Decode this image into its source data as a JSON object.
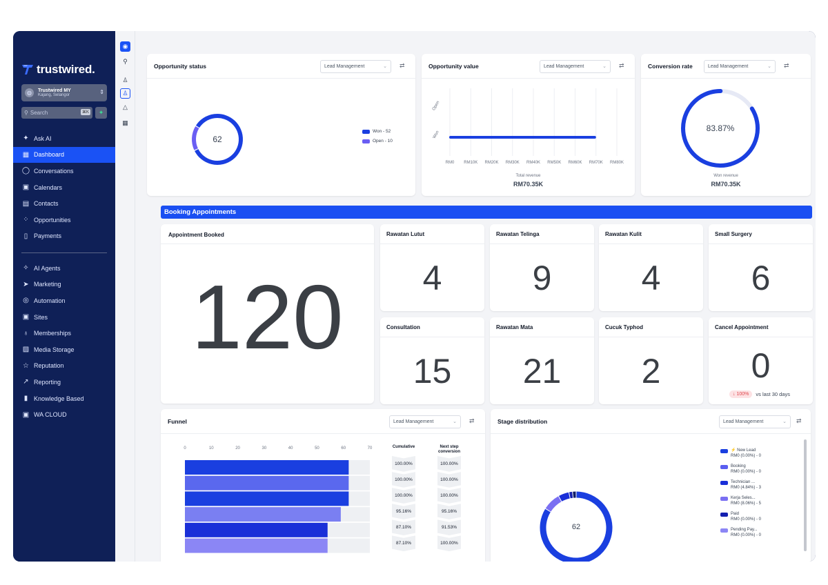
{
  "brand": {
    "name": "trustwired."
  },
  "account": {
    "name": "Trustwired MY",
    "location": "Kajang, Selangor"
  },
  "search": {
    "placeholder": "Search",
    "shortcut": "⌘K"
  },
  "nav_top": [
    {
      "label": "Ask AI",
      "icon": "sparkle-icon",
      "glyph": "✦"
    },
    {
      "label": "Dashboard",
      "icon": "dashboard-icon",
      "glyph": "▦",
      "active": true
    },
    {
      "label": "Conversations",
      "icon": "chat-icon",
      "glyph": "◯"
    },
    {
      "label": "Calendars",
      "icon": "calendar-icon",
      "glyph": "▣"
    },
    {
      "label": "Contacts",
      "icon": "contacts-icon",
      "glyph": "▤"
    },
    {
      "label": "Opportunities",
      "icon": "opportunities-icon",
      "glyph": "⁘"
    },
    {
      "label": "Payments",
      "icon": "payments-icon",
      "glyph": "▯"
    }
  ],
  "nav_bottom": [
    {
      "label": "AI Agents",
      "icon": "ai-agents-icon",
      "glyph": "✧"
    },
    {
      "label": "Marketing",
      "icon": "send-icon",
      "glyph": "➤"
    },
    {
      "label": "Automation",
      "icon": "automation-icon",
      "glyph": "◎"
    },
    {
      "label": "Sites",
      "icon": "sites-icon",
      "glyph": "▣"
    },
    {
      "label": "Memberships",
      "icon": "membership-icon",
      "glyph": "♁"
    },
    {
      "label": "Media Storage",
      "icon": "media-icon",
      "glyph": "▨"
    },
    {
      "label": "Reputation",
      "icon": "star-icon",
      "glyph": "☆"
    },
    {
      "label": "Reporting",
      "icon": "reporting-icon",
      "glyph": "↗"
    },
    {
      "label": "Knowledge Based",
      "icon": "book-icon",
      "glyph": "▮"
    },
    {
      "label": "WA CLOUD",
      "icon": "cloud-icon",
      "glyph": "▣"
    }
  ],
  "opportunity_status": {
    "title": "Opportunity status",
    "filter": "Lead Management",
    "total": "62",
    "legend": [
      {
        "label": "Won - 52",
        "value": 52,
        "color": "#1a3fe0"
      },
      {
        "label": "Open - 10",
        "value": 10,
        "color": "#6a5ef3"
      }
    ]
  },
  "opportunity_value": {
    "title": "Opportunity value",
    "filter": "Lead Management",
    "y_labels": [
      "Open",
      "Won"
    ],
    "x_ticks": [
      "RM0",
      "RM10K",
      "RM20K",
      "RM30K",
      "RM40K",
      "RM50K",
      "RM60K",
      "RM70K",
      "RM80K"
    ],
    "won_value": 70.35,
    "caption": "Total revenue",
    "total": "RM70.35K"
  },
  "conversion_rate": {
    "title": "Conversion rate",
    "filter": "Lead Management",
    "percent_label": "83.87%",
    "percent": 83.87,
    "caption": "Won revenue",
    "total": "RM70.35K"
  },
  "section": {
    "title": "Booking Appointments"
  },
  "appointment_booked": {
    "title": "Appointment Booked",
    "value": "120"
  },
  "stats": [
    {
      "title": "Rawatan Lutut",
      "value": "4"
    },
    {
      "title": "Rawatan Telinga",
      "value": "9"
    },
    {
      "title": "Rawatan Kulit",
      "value": "4"
    },
    {
      "title": "Small Surgery",
      "value": "6"
    },
    {
      "title": "Consultation",
      "value": "15"
    },
    {
      "title": "Rawatan Mata",
      "value": "21"
    },
    {
      "title": "Cucuk Typhod",
      "value": "2"
    },
    {
      "title": "Cancel Appointment",
      "value": "0"
    }
  ],
  "cancel_delta": {
    "badge": "↓ 100%",
    "text": "vs last 30 days"
  },
  "funnel": {
    "title": "Funnel",
    "filter": "Lead Management",
    "x_ticks": [
      "0",
      "10",
      "20",
      "30",
      "40",
      "50",
      "60",
      "70"
    ],
    "cumulative_header": "Cumulative",
    "next_step_header": "Next step conversion",
    "bars": [
      {
        "value": 62,
        "color": "#1a3fe0",
        "cumulative": "100.00%",
        "next": "100.00%"
      },
      {
        "value": 62,
        "color": "#5a68ee",
        "cumulative": "100.00%",
        "next": "100.00%"
      },
      {
        "value": 62,
        "color": "#1a3fe0",
        "cumulative": "100.00%",
        "next": "100.00%"
      },
      {
        "value": 59,
        "color": "#7a7ff2",
        "cumulative": "95.16%",
        "next": "95.16%"
      },
      {
        "value": 54,
        "color": "#1a2fd8",
        "cumulative": "87.10%",
        "next": "91.53%"
      },
      {
        "value": 54,
        "color": "#8b86f5",
        "cumulative": "87.10%",
        "next": "100.00%"
      }
    ]
  },
  "stage_distribution": {
    "title": "Stage distribution",
    "filter": "Lead Management",
    "total": "62",
    "legend": [
      {
        "name": "⚡ New Lead",
        "detail": "RM0 (0.00%) - 0",
        "color": "#1a3fe0"
      },
      {
        "name": "Booking",
        "detail": "RM0 (0.00%) - 0",
        "color": "#5a5ef0"
      },
      {
        "name": "Technician ...",
        "detail": "RM0 (4.84%) - 3",
        "color": "#1a2fd8"
      },
      {
        "name": "Kerja Seles...",
        "detail": "RM0 (8.06%) - 5",
        "color": "#7a6ff2"
      },
      {
        "name": "Paid",
        "detail": "RM0 (0.00%) - 0",
        "color": "#1420b0"
      },
      {
        "name": "Pending Pay...",
        "detail": "RM0 (0.00%) - 0",
        "color": "#8c86f5"
      }
    ],
    "slices": [
      {
        "value": 52,
        "color": "#1a3fe0"
      },
      {
        "value": 5,
        "color": "#7a6ff2"
      },
      {
        "value": 3,
        "color": "#1a2fd8"
      },
      {
        "value": 1,
        "color": "#1420b0"
      },
      {
        "value": 1,
        "color": "#0f1d66"
      }
    ]
  }
}
